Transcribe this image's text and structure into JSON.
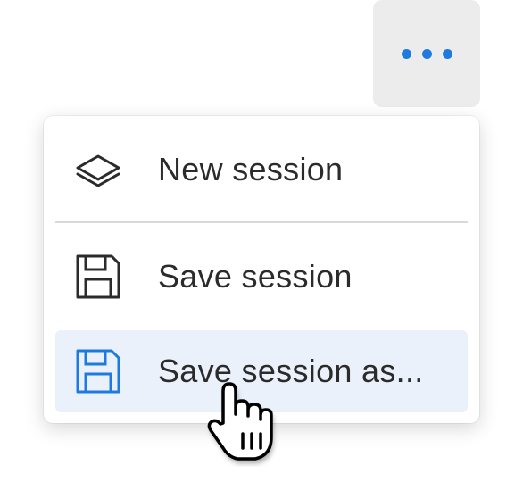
{
  "more_button": {
    "icon": "more-horizontal-icon",
    "accent_color": "#1f7ae0"
  },
  "menu": {
    "items": [
      {
        "label": "New session",
        "icon": "layers-icon"
      },
      {
        "label": "Save session",
        "icon": "floppy-disk-icon"
      },
      {
        "label": "Save session as...",
        "icon": "floppy-disk-icon",
        "state": "hovered"
      }
    ],
    "hover_background": "#eaf1fb"
  },
  "cursor": {
    "icon": "pointer-hand-cursor-icon"
  }
}
